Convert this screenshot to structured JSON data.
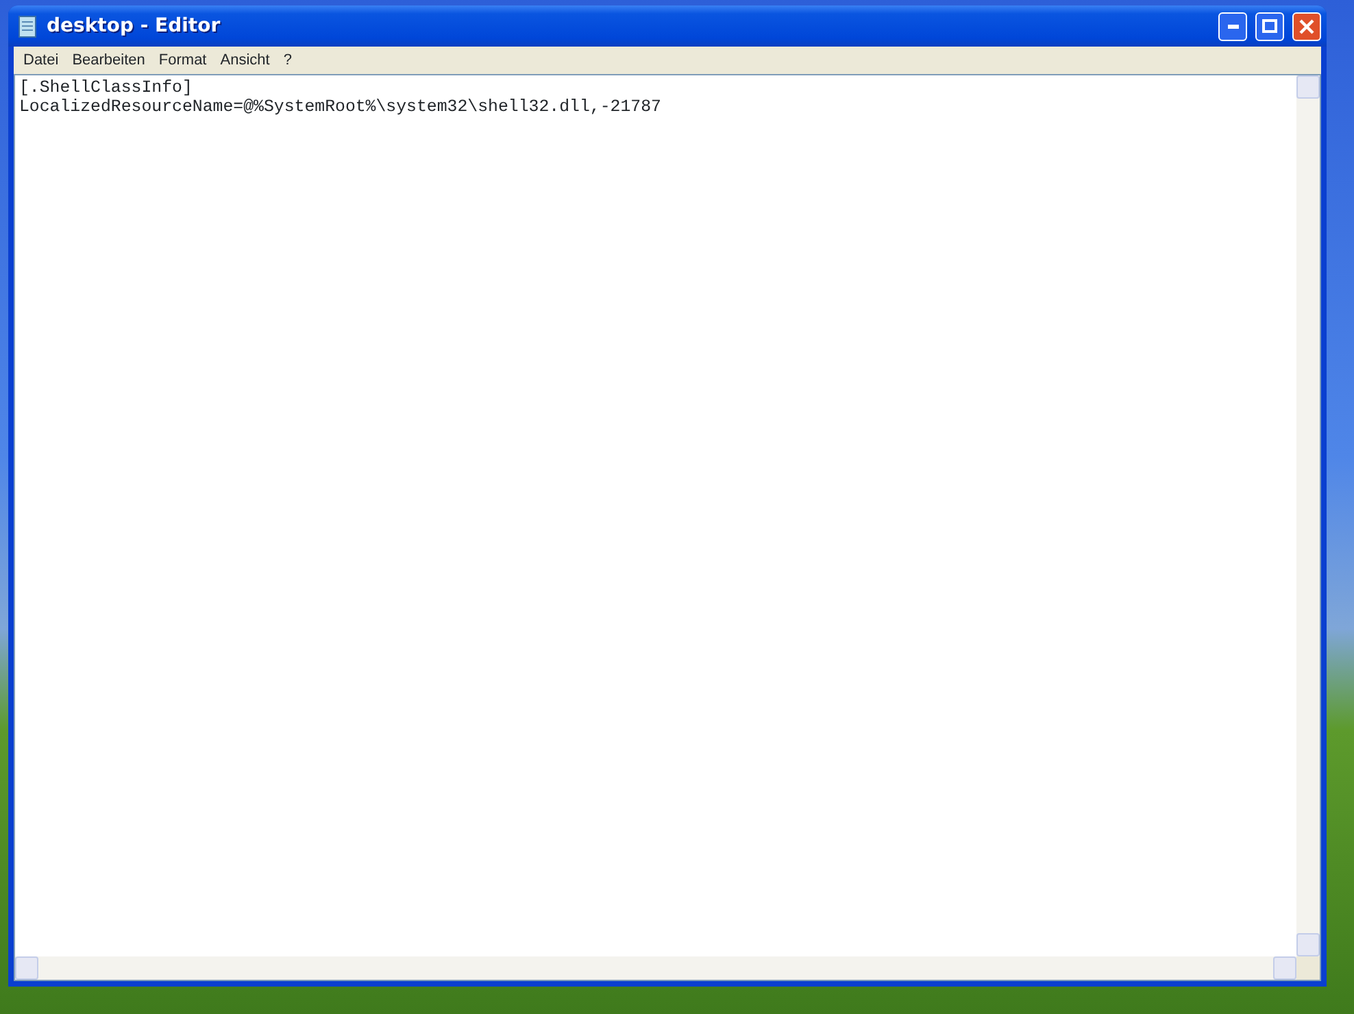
{
  "window": {
    "title": "desktop - Editor"
  },
  "menu": [
    "Datei",
    "Bearbeiten",
    "Format",
    "Ansicht",
    "?"
  ],
  "editor": {
    "lines": [
      "[.ShellClassInfo]",
      "LocalizedResourceName=@%SystemRoot%\\system32\\shell32.dll,-21787"
    ]
  }
}
